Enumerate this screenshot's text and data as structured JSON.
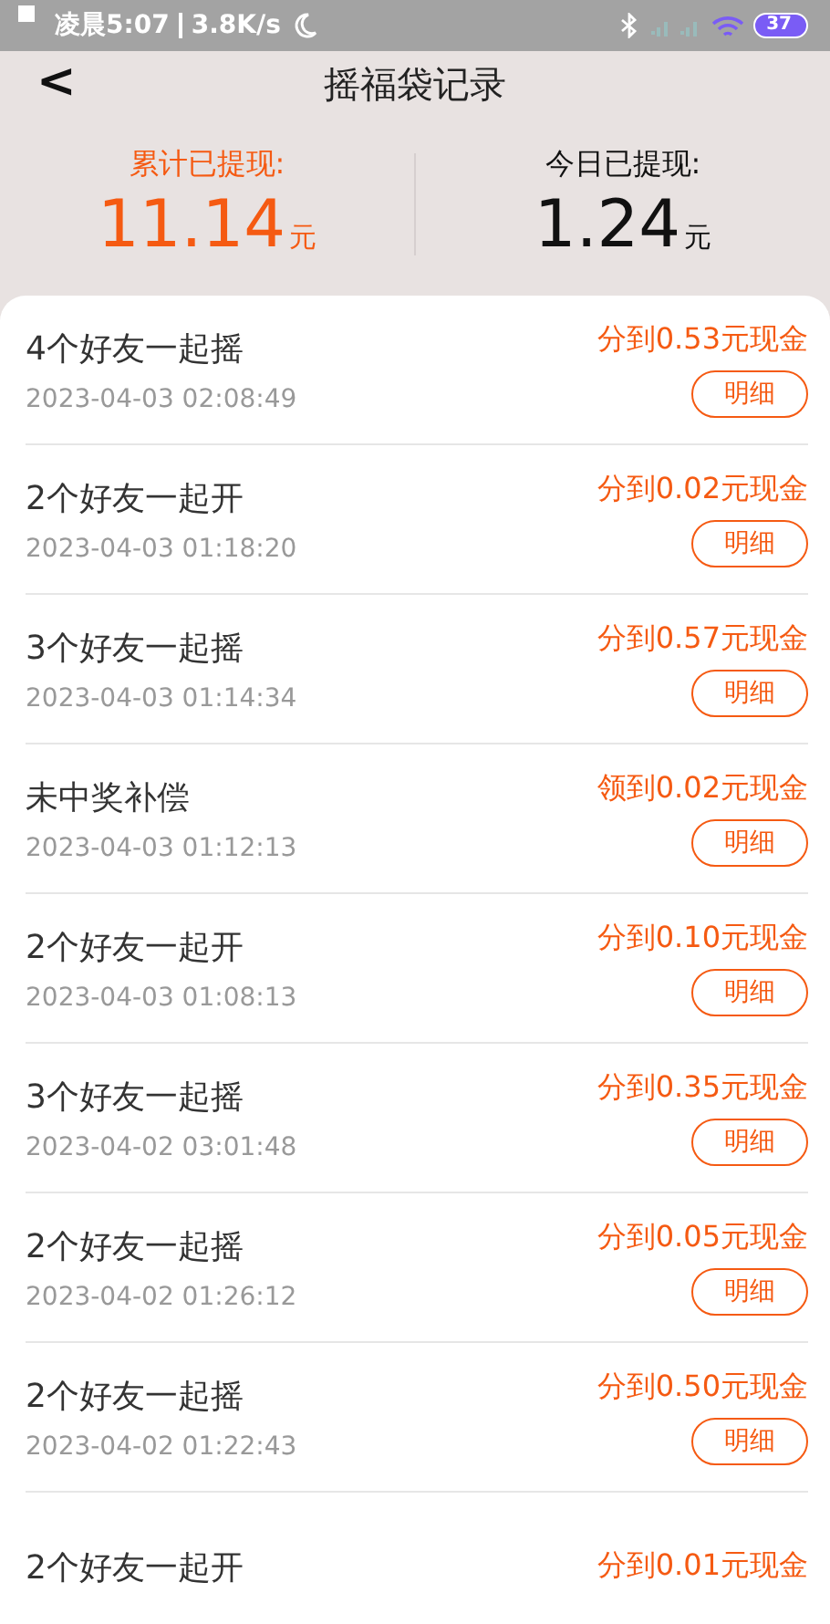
{
  "status_bar": {
    "time": "凌晨5:07",
    "speed": "3.8K/s",
    "battery": "37"
  },
  "nav": {
    "back": "<",
    "title": "摇福袋记录"
  },
  "summary": [
    {
      "label": "累计已提现:",
      "amount": "11.14",
      "unit": "元",
      "kind": "highlight"
    },
    {
      "label": "今日已提现:",
      "amount": "1.24",
      "unit": "元",
      "kind": "plain"
    }
  ],
  "records": [
    {
      "title": "4个好友一起摇",
      "time": "2023-04-03 02:08:49",
      "reward": "分到0.53元现金",
      "button": "明细"
    },
    {
      "title": "2个好友一起开",
      "time": "2023-04-03 01:18:20",
      "reward": "分到0.02元现金",
      "button": "明细"
    },
    {
      "title": "3个好友一起摇",
      "time": "2023-04-03 01:14:34",
      "reward": "分到0.57元现金",
      "button": "明细"
    },
    {
      "title": "未中奖补偿",
      "time": "2023-04-03 01:12:13",
      "reward": "领到0.02元现金",
      "button": "明细"
    },
    {
      "title": "2个好友一起开",
      "time": "2023-04-03 01:08:13",
      "reward": "分到0.10元现金",
      "button": "明细"
    },
    {
      "title": "3个好友一起摇",
      "time": "2023-04-02 03:01:48",
      "reward": "分到0.35元现金",
      "button": "明细"
    },
    {
      "title": "2个好友一起摇",
      "time": "2023-04-02 01:26:12",
      "reward": "分到0.05元现金",
      "button": "明细"
    },
    {
      "title": "2个好友一起摇",
      "time": "2023-04-02 01:22:43",
      "reward": "分到0.50元现金",
      "button": "明细"
    },
    {
      "title": "2个好友一起开",
      "reward": "分到0.01元现金"
    }
  ]
}
